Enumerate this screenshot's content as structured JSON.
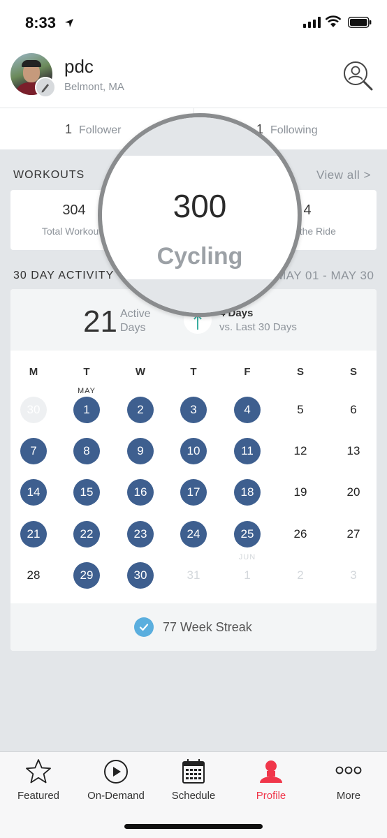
{
  "status_bar": {
    "time": "8:33"
  },
  "profile": {
    "username": "pdc",
    "location": "Belmont, MA"
  },
  "follow": {
    "followers_count": "1",
    "followers_label": "Follower",
    "following_count": "1",
    "following_label": "Following"
  },
  "workouts": {
    "title": "WORKOUTS",
    "view_all": "View all >",
    "stats": [
      {
        "value": "304",
        "label": "Total Workouts"
      },
      {
        "value": "4",
        "label": "Just the Ride"
      }
    ]
  },
  "magnifier": {
    "value": "300",
    "label": "Cycling"
  },
  "activity": {
    "title": "30 DAY ACTIVITY",
    "range": "MAY 01 - MAY 30",
    "active_days_value": "21",
    "active_days_label_1": "Active",
    "active_days_label_2": "Days",
    "delta_value": "4 Days",
    "delta_label": "vs. Last 30 Days",
    "weekday_headers": [
      "M",
      "T",
      "W",
      "T",
      "F",
      "S",
      "S"
    ],
    "month_label_may": "MAY",
    "month_label_jun": "JUN",
    "weeks": [
      [
        {
          "d": "30",
          "s": "faded-bg"
        },
        {
          "d": "1",
          "s": "active"
        },
        {
          "d": "2",
          "s": "active"
        },
        {
          "d": "3",
          "s": "active"
        },
        {
          "d": "4",
          "s": "active"
        },
        {
          "d": "5",
          "s": "plain"
        },
        {
          "d": "6",
          "s": "plain"
        }
      ],
      [
        {
          "d": "7",
          "s": "active"
        },
        {
          "d": "8",
          "s": "active"
        },
        {
          "d": "9",
          "s": "active"
        },
        {
          "d": "10",
          "s": "active"
        },
        {
          "d": "11",
          "s": "active"
        },
        {
          "d": "12",
          "s": "plain"
        },
        {
          "d": "13",
          "s": "plain"
        }
      ],
      [
        {
          "d": "14",
          "s": "active"
        },
        {
          "d": "15",
          "s": "active"
        },
        {
          "d": "16",
          "s": "active"
        },
        {
          "d": "17",
          "s": "active"
        },
        {
          "d": "18",
          "s": "active"
        },
        {
          "d": "19",
          "s": "plain"
        },
        {
          "d": "20",
          "s": "plain"
        }
      ],
      [
        {
          "d": "21",
          "s": "active"
        },
        {
          "d": "22",
          "s": "active"
        },
        {
          "d": "23",
          "s": "active"
        },
        {
          "d": "24",
          "s": "active"
        },
        {
          "d": "25",
          "s": "active"
        },
        {
          "d": "26",
          "s": "plain"
        },
        {
          "d": "27",
          "s": "plain"
        }
      ],
      [
        {
          "d": "28",
          "s": "plain"
        },
        {
          "d": "29",
          "s": "active"
        },
        {
          "d": "30",
          "s": "active"
        },
        {
          "d": "31",
          "s": "faded"
        },
        {
          "d": "1",
          "s": "faded"
        },
        {
          "d": "2",
          "s": "faded"
        },
        {
          "d": "3",
          "s": "faded"
        }
      ]
    ],
    "streak_label": "77 Week Streak"
  },
  "tabs": [
    {
      "label": "Featured",
      "icon": "star-icon",
      "active": false
    },
    {
      "label": "On-Demand",
      "icon": "play-icon",
      "active": false
    },
    {
      "label": "Schedule",
      "icon": "calendar-icon",
      "active": false
    },
    {
      "label": "Profile",
      "icon": "person-icon",
      "active": true
    },
    {
      "label": "More",
      "icon": "more-dots-icon",
      "active": false
    }
  ],
  "colors": {
    "active_day": "#3e5f8f",
    "accent_red": "#f0364a",
    "streak_check": "#5aaede",
    "background": "#e3e6e9"
  }
}
